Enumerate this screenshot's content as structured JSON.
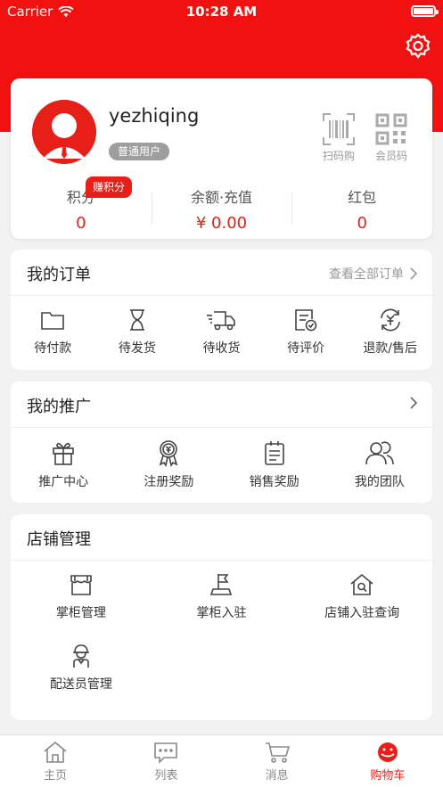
{
  "status_bar": {
    "carrier": "Carrier",
    "time": "10:28 AM"
  },
  "profile": {
    "username": "yezhiqing",
    "badge": "普通用户",
    "scan_label": "扫码购",
    "member_code_label": "会员码",
    "earn_badge": "赚积分",
    "stats": [
      {
        "label": "积分",
        "value": "0"
      },
      {
        "label": "余额·充值",
        "value": "¥ 0.00"
      },
      {
        "label": "红包",
        "value": "0"
      }
    ]
  },
  "orders": {
    "title": "我的订单",
    "more": "查看全部订单",
    "items": [
      {
        "label": "待付款",
        "icon": "folder-icon"
      },
      {
        "label": "待发货",
        "icon": "hourglass-icon"
      },
      {
        "label": "待收货",
        "icon": "truck-icon"
      },
      {
        "label": "待评价",
        "icon": "review-icon"
      },
      {
        "label": "退款/售后",
        "icon": "refund-icon"
      }
    ]
  },
  "promotion": {
    "title": "我的推广",
    "items": [
      {
        "label": "推广中心",
        "icon": "gift-icon"
      },
      {
        "label": "注册奖励",
        "icon": "award-icon"
      },
      {
        "label": "销售奖励",
        "icon": "clipboard-icon"
      },
      {
        "label": "我的团队",
        "icon": "team-icon"
      }
    ]
  },
  "shop": {
    "title": "店铺管理",
    "items": [
      {
        "label": "掌柜管理",
        "icon": "store-icon"
      },
      {
        "label": "掌柜入驻",
        "icon": "flag-icon"
      },
      {
        "label": "店铺入驻查询",
        "icon": "house-search-icon"
      },
      {
        "label": "配送员管理",
        "icon": "courier-icon"
      }
    ]
  },
  "tabbar": [
    {
      "label": "主页",
      "icon": "home-icon"
    },
    {
      "label": "列表",
      "icon": "message-list-icon"
    },
    {
      "label": "消息",
      "icon": "cart-icon"
    },
    {
      "label": "购物车",
      "icon": "cart-active-icon"
    }
  ],
  "colors": {
    "brand": "#f21111",
    "accent": "#e61f19"
  }
}
